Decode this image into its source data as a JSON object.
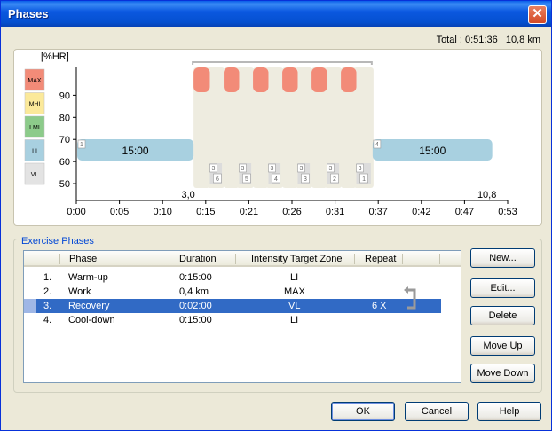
{
  "window": {
    "title": "Phases"
  },
  "total": {
    "label": "Total :",
    "time": "0:51:36",
    "distance": "10,8 km"
  },
  "chart_data": {
    "type": "area",
    "ylabel": "[%HR]",
    "yticks": [
      50,
      60,
      70,
      80,
      90
    ],
    "ylim": [
      44,
      103
    ],
    "xticks": [
      "0:00",
      "0:05",
      "0:10",
      "0:15",
      "0:21",
      "0:26",
      "0:31",
      "0:37",
      "0:42",
      "0:47",
      "0:53"
    ],
    "xlim": [
      0,
      53
    ],
    "zones": [
      {
        "label": "MAX",
        "color": "#f28b78"
      },
      {
        "label": "MHI",
        "color": "#fbe99a"
      },
      {
        "label": "LMI",
        "color": "#8ccb8a"
      },
      {
        "label": "LI",
        "color": "#a8d0e0"
      },
      {
        "label": "VL",
        "color": "#e3e3e3"
      }
    ],
    "phases": [
      {
        "marker": "1",
        "text": "15:00",
        "start": 0,
        "end": 14.3,
        "zone": "LI"
      },
      {
        "marker": "4",
        "text": "15:00",
        "start": 36.3,
        "end": 51,
        "zone": "LI"
      }
    ],
    "intervals": [
      {
        "work_start": 14.3,
        "work_end": 16.3,
        "rec_end": 18.0,
        "rec_marker": "6"
      },
      {
        "work_start": 18.0,
        "work_end": 19.9,
        "rec_end": 21.6,
        "rec_marker": "5"
      },
      {
        "work_start": 21.6,
        "work_end": 23.5,
        "rec_end": 25.2,
        "rec_marker": "4"
      },
      {
        "work_start": 25.2,
        "work_end": 27.1,
        "rec_end": 28.8,
        "rec_marker": "3"
      },
      {
        "work_start": 28.8,
        "work_end": 30.7,
        "rec_end": 32.4,
        "rec_marker": "2"
      },
      {
        "work_start": 32.4,
        "work_end": 34.3,
        "rec_end": 36.3,
        "rec_marker": "1"
      }
    ],
    "interval_phase_marker": "3",
    "distance_marks": [
      {
        "x": 14.3,
        "text": "3,0"
      },
      {
        "x": 51,
        "text": "10,8"
      }
    ]
  },
  "exercise_phases": {
    "group_label": "Exercise Phases",
    "columns": [
      "Phase",
      "Duration",
      "Intensity Target Zone",
      "Repeat"
    ],
    "rows": [
      {
        "num": "1.",
        "phase": "Warm-up",
        "duration": "0:15:00",
        "zone": "LI",
        "repeat": ""
      },
      {
        "num": "2.",
        "phase": "Work",
        "duration": "0,4  km",
        "zone": "MAX",
        "repeat": ""
      },
      {
        "num": "3.",
        "phase": "Recovery",
        "duration": "0:02:00",
        "zone": "VL",
        "repeat": "6 X"
      },
      {
        "num": "4.",
        "phase": "Cool-down",
        "duration": "0:15:00",
        "zone": "LI",
        "repeat": ""
      }
    ],
    "selected_row": 2
  },
  "side_buttons": {
    "new": "New...",
    "edit": "Edit...",
    "delete": "Delete",
    "move_up": "Move Up",
    "move_down": "Move Down"
  },
  "bottom_buttons": {
    "ok": "OK",
    "cancel": "Cancel",
    "help": "Help"
  }
}
